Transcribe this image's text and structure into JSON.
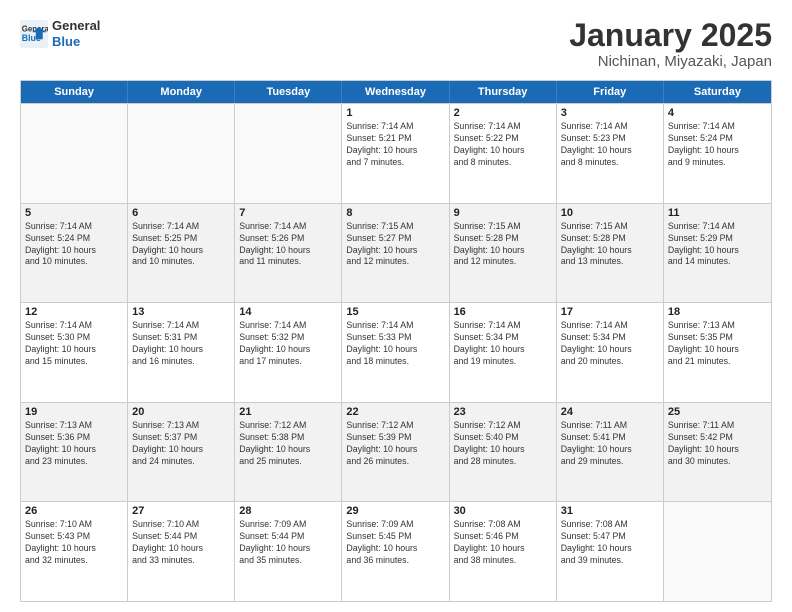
{
  "header": {
    "logo_line1": "General",
    "logo_line2": "Blue",
    "title": "January 2025",
    "subtitle": "Nichinan, Miyazaki, Japan"
  },
  "weekdays": [
    "Sunday",
    "Monday",
    "Tuesday",
    "Wednesday",
    "Thursday",
    "Friday",
    "Saturday"
  ],
  "rows": [
    [
      {
        "day": "",
        "info": ""
      },
      {
        "day": "",
        "info": ""
      },
      {
        "day": "",
        "info": ""
      },
      {
        "day": "1",
        "info": "Sunrise: 7:14 AM\nSunset: 5:21 PM\nDaylight: 10 hours\nand 7 minutes."
      },
      {
        "day": "2",
        "info": "Sunrise: 7:14 AM\nSunset: 5:22 PM\nDaylight: 10 hours\nand 8 minutes."
      },
      {
        "day": "3",
        "info": "Sunrise: 7:14 AM\nSunset: 5:23 PM\nDaylight: 10 hours\nand 8 minutes."
      },
      {
        "day": "4",
        "info": "Sunrise: 7:14 AM\nSunset: 5:24 PM\nDaylight: 10 hours\nand 9 minutes."
      }
    ],
    [
      {
        "day": "5",
        "info": "Sunrise: 7:14 AM\nSunset: 5:24 PM\nDaylight: 10 hours\nand 10 minutes."
      },
      {
        "day": "6",
        "info": "Sunrise: 7:14 AM\nSunset: 5:25 PM\nDaylight: 10 hours\nand 10 minutes."
      },
      {
        "day": "7",
        "info": "Sunrise: 7:14 AM\nSunset: 5:26 PM\nDaylight: 10 hours\nand 11 minutes."
      },
      {
        "day": "8",
        "info": "Sunrise: 7:15 AM\nSunset: 5:27 PM\nDaylight: 10 hours\nand 12 minutes."
      },
      {
        "day": "9",
        "info": "Sunrise: 7:15 AM\nSunset: 5:28 PM\nDaylight: 10 hours\nand 12 minutes."
      },
      {
        "day": "10",
        "info": "Sunrise: 7:15 AM\nSunset: 5:28 PM\nDaylight: 10 hours\nand 13 minutes."
      },
      {
        "day": "11",
        "info": "Sunrise: 7:14 AM\nSunset: 5:29 PM\nDaylight: 10 hours\nand 14 minutes."
      }
    ],
    [
      {
        "day": "12",
        "info": "Sunrise: 7:14 AM\nSunset: 5:30 PM\nDaylight: 10 hours\nand 15 minutes."
      },
      {
        "day": "13",
        "info": "Sunrise: 7:14 AM\nSunset: 5:31 PM\nDaylight: 10 hours\nand 16 minutes."
      },
      {
        "day": "14",
        "info": "Sunrise: 7:14 AM\nSunset: 5:32 PM\nDaylight: 10 hours\nand 17 minutes."
      },
      {
        "day": "15",
        "info": "Sunrise: 7:14 AM\nSunset: 5:33 PM\nDaylight: 10 hours\nand 18 minutes."
      },
      {
        "day": "16",
        "info": "Sunrise: 7:14 AM\nSunset: 5:34 PM\nDaylight: 10 hours\nand 19 minutes."
      },
      {
        "day": "17",
        "info": "Sunrise: 7:14 AM\nSunset: 5:34 PM\nDaylight: 10 hours\nand 20 minutes."
      },
      {
        "day": "18",
        "info": "Sunrise: 7:13 AM\nSunset: 5:35 PM\nDaylight: 10 hours\nand 21 minutes."
      }
    ],
    [
      {
        "day": "19",
        "info": "Sunrise: 7:13 AM\nSunset: 5:36 PM\nDaylight: 10 hours\nand 23 minutes."
      },
      {
        "day": "20",
        "info": "Sunrise: 7:13 AM\nSunset: 5:37 PM\nDaylight: 10 hours\nand 24 minutes."
      },
      {
        "day": "21",
        "info": "Sunrise: 7:12 AM\nSunset: 5:38 PM\nDaylight: 10 hours\nand 25 minutes."
      },
      {
        "day": "22",
        "info": "Sunrise: 7:12 AM\nSunset: 5:39 PM\nDaylight: 10 hours\nand 26 minutes."
      },
      {
        "day": "23",
        "info": "Sunrise: 7:12 AM\nSunset: 5:40 PM\nDaylight: 10 hours\nand 28 minutes."
      },
      {
        "day": "24",
        "info": "Sunrise: 7:11 AM\nSunset: 5:41 PM\nDaylight: 10 hours\nand 29 minutes."
      },
      {
        "day": "25",
        "info": "Sunrise: 7:11 AM\nSunset: 5:42 PM\nDaylight: 10 hours\nand 30 minutes."
      }
    ],
    [
      {
        "day": "26",
        "info": "Sunrise: 7:10 AM\nSunset: 5:43 PM\nDaylight: 10 hours\nand 32 minutes."
      },
      {
        "day": "27",
        "info": "Sunrise: 7:10 AM\nSunset: 5:44 PM\nDaylight: 10 hours\nand 33 minutes."
      },
      {
        "day": "28",
        "info": "Sunrise: 7:09 AM\nSunset: 5:44 PM\nDaylight: 10 hours\nand 35 minutes."
      },
      {
        "day": "29",
        "info": "Sunrise: 7:09 AM\nSunset: 5:45 PM\nDaylight: 10 hours\nand 36 minutes."
      },
      {
        "day": "30",
        "info": "Sunrise: 7:08 AM\nSunset: 5:46 PM\nDaylight: 10 hours\nand 38 minutes."
      },
      {
        "day": "31",
        "info": "Sunrise: 7:08 AM\nSunset: 5:47 PM\nDaylight: 10 hours\nand 39 minutes."
      },
      {
        "day": "",
        "info": ""
      }
    ]
  ]
}
